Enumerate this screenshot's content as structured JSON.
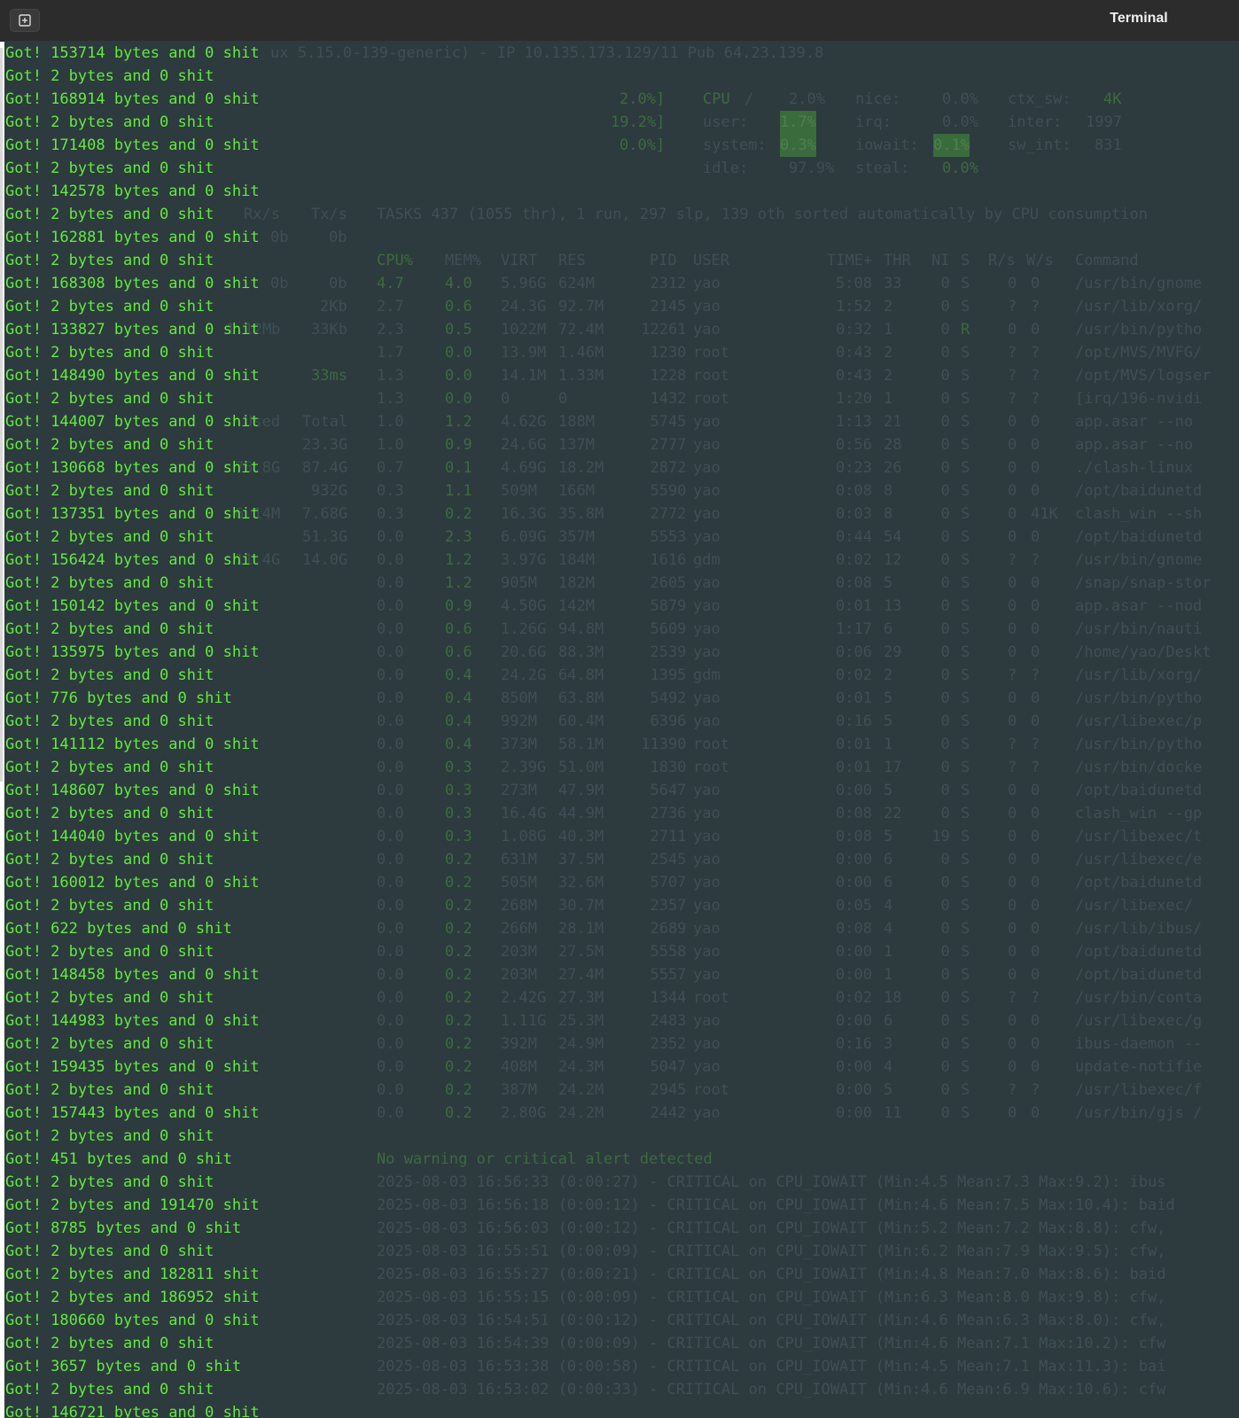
{
  "window": {
    "title": "Terminal",
    "new_tab_icon": "new-tab-icon"
  },
  "foreground_output": [
    "Got! 153714 bytes and 0 shit",
    "Got! 2 bytes and 0 shit",
    "Got! 168914 bytes and 0 shit",
    "Got! 2 bytes and 0 shit",
    "Got! 171408 bytes and 0 shit",
    "Got! 2 bytes and 0 shit",
    "Got! 142578 bytes and 0 shit",
    "Got! 2 bytes and 0 shit",
    "Got! 162881 bytes and 0 shit",
    "Got! 2 bytes and 0 shit",
    "Got! 168308 bytes and 0 shit",
    "Got! 2 bytes and 0 shit",
    "Got! 133827 bytes and 0 shit",
    "Got! 2 bytes and 0 shit",
    "Got! 148490 bytes and 0 shit",
    "Got! 2 bytes and 0 shit",
    "Got! 144007 bytes and 0 shit",
    "Got! 2 bytes and 0 shit",
    "Got! 130668 bytes and 0 shit",
    "Got! 2 bytes and 0 shit",
    "Got! 137351 bytes and 0 shit",
    "Got! 2 bytes and 0 shit",
    "Got! 156424 bytes and 0 shit",
    "Got! 2 bytes and 0 shit",
    "Got! 150142 bytes and 0 shit",
    "Got! 2 bytes and 0 shit",
    "Got! 135975 bytes and 0 shit",
    "Got! 2 bytes and 0 shit",
    "Got! 776 bytes and 0 shit",
    "Got! 2 bytes and 0 shit",
    "Got! 141112 bytes and 0 shit",
    "Got! 2 bytes and 0 shit",
    "Got! 148607 bytes and 0 shit",
    "Got! 2 bytes and 0 shit",
    "Got! 144040 bytes and 0 shit",
    "Got! 2 bytes and 0 shit",
    "Got! 160012 bytes and 0 shit",
    "Got! 2 bytes and 0 shit",
    "Got! 622 bytes and 0 shit",
    "Got! 2 bytes and 0 shit",
    "Got! 148458 bytes and 0 shit",
    "Got! 2 bytes and 0 shit",
    "Got! 144983 bytes and 0 shit",
    "Got! 2 bytes and 0 shit",
    "Got! 159435 bytes and 0 shit",
    "Got! 2 bytes and 0 shit",
    "Got! 157443 bytes and 0 shit",
    "Got! 2 bytes and 0 shit",
    "Got! 451 bytes and 0 shit",
    "Got! 2 bytes and 0 shit",
    "Got! 2 bytes and 191470 shit",
    "Got! 8785 bytes and 0 shit",
    "Got! 2 bytes and 0 shit",
    "Got! 2 bytes and 182811 shit",
    "Got! 2 bytes and 186952 shit",
    "Got! 180660 bytes and 0 shit",
    "Got! 2 bytes and 0 shit",
    "Got! 3657 bytes and 0 shit",
    "Got! 2 bytes and 0 shit",
    "Got! 146721 bytes and 0 shit"
  ],
  "glances": {
    "system_line": "ux 5.15.0-139-generic) - IP 10.135.173.129/11 Pub 64.23.139.8",
    "cpu": {
      "label": "CPU",
      "total": "2.0%",
      "user": "1.7%",
      "system": "0.3%",
      "idle": "97.9%",
      "nice": "0.0%",
      "irq": "0.0%",
      "iowait": "0.1%",
      "steal": "0.0%",
      "ctx_sw": "4K",
      "inter": "1997",
      "sw_int": "831",
      "left_bars": [
        "2.0%]",
        "19.2%]",
        "0.0%]"
      ]
    },
    "net_header": [
      "Rx/s",
      "Tx/s"
    ],
    "left_fragments": [
      "0b",
      "0b",
      "2Kb",
      "1.12Mb",
      "33Kb",
      "33ms",
      "Used",
      "Total",
      "23.3G",
      "75.8G",
      "87.4G",
      "932G",
      "6.14M",
      "7.68G",
      "51.3G",
      "11.4G",
      "14.0G"
    ],
    "tasks_line": "TASKS 437 (1055 thr), 1 run, 297 slp, 139 oth sorted automatically by CPU consumption",
    "proc_header": [
      "CPU%",
      "MEM%",
      "VIRT",
      "RES",
      "PID",
      "USER",
      "TIME+",
      "THR",
      "NI",
      "S",
      "R/s",
      "W/s",
      "Command"
    ],
    "processes": [
      [
        "4.7",
        "4.0",
        "5.96G",
        "624M",
        "2312",
        "yao",
        "5:08",
        "33",
        "0",
        "S",
        "0",
        "0",
        "/usr/bin/gnome"
      ],
      [
        "2.7",
        "0.6",
        "24.3G",
        "92.7M",
        "2145",
        "yao",
        "1:52",
        "2",
        "0",
        "S",
        "?",
        "?",
        "/usr/lib/xorg/"
      ],
      [
        "2.3",
        "0.5",
        "1022M",
        "72.4M",
        "12261",
        "yao",
        "0:32",
        "1",
        "0",
        "R",
        "0",
        "0",
        "/usr/bin/pytho"
      ],
      [
        "1.7",
        "0.0",
        "13.9M",
        "1.46M",
        "1230",
        "root",
        "0:43",
        "2",
        "0",
        "S",
        "?",
        "?",
        "/opt/MVS/MVFG/"
      ],
      [
        "1.3",
        "0.0",
        "14.1M",
        "1.33M",
        "1228",
        "root",
        "0:43",
        "2",
        "0",
        "S",
        "?",
        "?",
        "/opt/MVS/logser"
      ],
      [
        "1.3",
        "0.0",
        "0",
        "0",
        "1432",
        "root",
        "1:20",
        "1",
        "0",
        "S",
        "?",
        "?",
        "[irq/196-nvidi"
      ],
      [
        "1.0",
        "1.2",
        "4.62G",
        "188M",
        "5745",
        "yao",
        "1:13",
        "21",
        "0",
        "S",
        "0",
        "0",
        "app.asar --no"
      ],
      [
        "1.0",
        "0.9",
        "24.6G",
        "137M",
        "2777",
        "yao",
        "0:56",
        "28",
        "0",
        "S",
        "0",
        "0",
        "app.asar --no"
      ],
      [
        "0.7",
        "0.1",
        "4.69G",
        "18.2M",
        "2872",
        "yao",
        "0:23",
        "26",
        "0",
        "S",
        "0",
        "0",
        "./clash-linux"
      ],
      [
        "0.3",
        "1.1",
        "509M",
        "166M",
        "5590",
        "yao",
        "0:08",
        "8",
        "0",
        "S",
        "0",
        "0",
        "/opt/baidunetd"
      ],
      [
        "0.3",
        "0.2",
        "16.3G",
        "35.8M",
        "2772",
        "yao",
        "0:03",
        "8",
        "0",
        "S",
        "0",
        "41K",
        "clash_win --sh"
      ],
      [
        "0.0",
        "2.3",
        "6.09G",
        "357M",
        "5553",
        "yao",
        "0:44",
        "54",
        "0",
        "S",
        "0",
        "0",
        "/opt/baidunetd"
      ],
      [
        "0.0",
        "1.2",
        "3.97G",
        "184M",
        "1616",
        "gdm",
        "0:02",
        "12",
        "0",
        "S",
        "?",
        "?",
        "/usr/bin/gnome"
      ],
      [
        "0.0",
        "1.2",
        "905M",
        "182M",
        "2605",
        "yao",
        "0:08",
        "5",
        "0",
        "S",
        "0",
        "0",
        "/snap/snap-stor"
      ],
      [
        "0.0",
        "0.9",
        "4.50G",
        "142M",
        "5879",
        "yao",
        "0:01",
        "13",
        "0",
        "S",
        "0",
        "0",
        "app.asar --nod"
      ],
      [
        "0.0",
        "0.6",
        "1.26G",
        "94.8M",
        "5609",
        "yao",
        "1:17",
        "6",
        "0",
        "S",
        "0",
        "0",
        "/usr/bin/nauti"
      ],
      [
        "0.0",
        "0.6",
        "20.6G",
        "88.3M",
        "2539",
        "yao",
        "0:06",
        "29",
        "0",
        "S",
        "0",
        "0",
        "/home/yao/Deskt"
      ],
      [
        "0.0",
        "0.4",
        "24.2G",
        "64.8M",
        "1395",
        "gdm",
        "0:02",
        "2",
        "0",
        "S",
        "?",
        "?",
        "/usr/lib/xorg/"
      ],
      [
        "0.0",
        "0.4",
        "850M",
        "63.8M",
        "5492",
        "yao",
        "0:01",
        "5",
        "0",
        "S",
        "0",
        "0",
        "/usr/bin/pytho"
      ],
      [
        "0.0",
        "0.4",
        "992M",
        "60.4M",
        "6396",
        "yao",
        "0:16",
        "5",
        "0",
        "S",
        "0",
        "0",
        "/usr/libexec/p"
      ],
      [
        "0.0",
        "0.4",
        "373M",
        "58.1M",
        "11390",
        "root",
        "0:01",
        "1",
        "0",
        "S",
        "?",
        "?",
        "/usr/bin/pytho"
      ],
      [
        "0.0",
        "0.3",
        "2.39G",
        "51.0M",
        "1830",
        "root",
        "0:01",
        "17",
        "0",
        "S",
        "?",
        "?",
        "/usr/bin/docke"
      ],
      [
        "0.0",
        "0.3",
        "273M",
        "47.9M",
        "5647",
        "yao",
        "0:00",
        "5",
        "0",
        "S",
        "0",
        "0",
        "/opt/baidunetd"
      ],
      [
        "0.0",
        "0.3",
        "16.4G",
        "44.9M",
        "2736",
        "yao",
        "0:08",
        "22",
        "0",
        "S",
        "0",
        "0",
        "clash_win --gp"
      ],
      [
        "0.0",
        "0.3",
        "1.08G",
        "40.3M",
        "2711",
        "yao",
        "0:08",
        "5",
        "19",
        "S",
        "0",
        "0",
        "/usr/libexec/t"
      ],
      [
        "0.0",
        "0.2",
        "631M",
        "37.5M",
        "2545",
        "yao",
        "0:00",
        "6",
        "0",
        "S",
        "0",
        "0",
        "/usr/libexec/e"
      ],
      [
        "0.0",
        "0.2",
        "505M",
        "32.6M",
        "5707",
        "yao",
        "0:00",
        "6",
        "0",
        "S",
        "0",
        "0",
        "/opt/baidunetd"
      ],
      [
        "0.0",
        "0.2",
        "268M",
        "30.7M",
        "2357",
        "yao",
        "0:05",
        "4",
        "0",
        "S",
        "0",
        "0",
        "/usr/libexec/"
      ],
      [
        "0.0",
        "0.2",
        "266M",
        "28.1M",
        "2689",
        "yao",
        "0:08",
        "4",
        "0",
        "S",
        "0",
        "0",
        "/usr/lib/ibus/"
      ],
      [
        "0.0",
        "0.2",
        "203M",
        "27.5M",
        "5558",
        "yao",
        "0:00",
        "1",
        "0",
        "S",
        "0",
        "0",
        "/opt/baidunetd"
      ],
      [
        "0.0",
        "0.2",
        "203M",
        "27.4M",
        "5557",
        "yao",
        "0:00",
        "1",
        "0",
        "S",
        "0",
        "0",
        "/opt/baidunetd"
      ],
      [
        "0.0",
        "0.2",
        "2.42G",
        "27.3M",
        "1344",
        "root",
        "0:02",
        "18",
        "0",
        "S",
        "?",
        "?",
        "/usr/bin/conta"
      ],
      [
        "0.0",
        "0.2",
        "1.11G",
        "25.3M",
        "2483",
        "yao",
        "0:00",
        "6",
        "0",
        "S",
        "0",
        "0",
        "/usr/libexec/g"
      ],
      [
        "0.0",
        "0.2",
        "392M",
        "24.9M",
        "2352",
        "yao",
        "0:16",
        "3",
        "0",
        "S",
        "0",
        "0",
        "ibus-daemon --"
      ],
      [
        "0.0",
        "0.2",
        "408M",
        "24.3M",
        "5047",
        "yao",
        "0:00",
        "4",
        "0",
        "S",
        "0",
        "0",
        "update-notifie"
      ],
      [
        "0.0",
        "0.2",
        "387M",
        "24.2M",
        "2945",
        "root",
        "0:00",
        "5",
        "0",
        "S",
        "?",
        "?",
        "/usr/libexec/f"
      ],
      [
        "0.0",
        "0.2",
        "2.80G",
        "24.2M",
        "2442",
        "yao",
        "0:00",
        "11",
        "0",
        "S",
        "0",
        "0",
        "/usr/bin/gjs /"
      ]
    ],
    "alert_header": "No warning or critical alert detected",
    "alerts": [
      "2025-08-03 16:56:33 (0:00:27) - CRITICAL on CPU_IOWAIT (Min:4.5 Mean:7.3 Max:9.2): ibus",
      "2025-08-03 16:56:18 (0:00:12) - CRITICAL on CPU_IOWAIT (Min:4.6 Mean:7.5 Max:10.4): baid",
      "2025-08-03 16:56:03 (0:00:12) - CRITICAL on CPU_IOWAIT (Min:5.2 Mean:7.2 Max:8.8): cfw,",
      "2025-08-03 16:55:51 (0:00:09) - CRITICAL on CPU_IOWAIT (Min:6.2 Mean:7.9 Max:9.5): cfw,",
      "2025-08-03 16:55:27 (0:00:21) - CRITICAL on CPU_IOWAIT (Min:4.8 Mean:7.0 Max:8.6): baid",
      "2025-08-03 16:55:15 (0:00:09) - CRITICAL on CPU_IOWAIT (Min:6.3 Mean:8.0 Max:9.8): cfw,",
      "2025-08-03 16:54:51 (0:00:12) - CRITICAL on CPU_IOWAIT (Min:4.6 Mean:6.3 Max:8.0): cfw,",
      "2025-08-03 16:54:39 (0:00:09) - CRITICAL on CPU_IOWAIT (Min:4.6 Mean:7.1 Max:10.2): cfw",
      "2025-08-03 16:53:38 (0:00:58) - CRITICAL on CPU_IOWAIT (Min:4.5 Mean:7.1 Max:11.3): bai",
      "2025-08-03 16:53:02 (0:00:33) - CRITICAL on CPU_IOWAIT (Min:4.6 Mean:6.9 Max:10.6): cfw"
    ]
  },
  "colors": {
    "terminal_bg": "#2d3a3e",
    "text_green": "#63ea3e",
    "titlebar_bg": "#2c2c2c"
  }
}
